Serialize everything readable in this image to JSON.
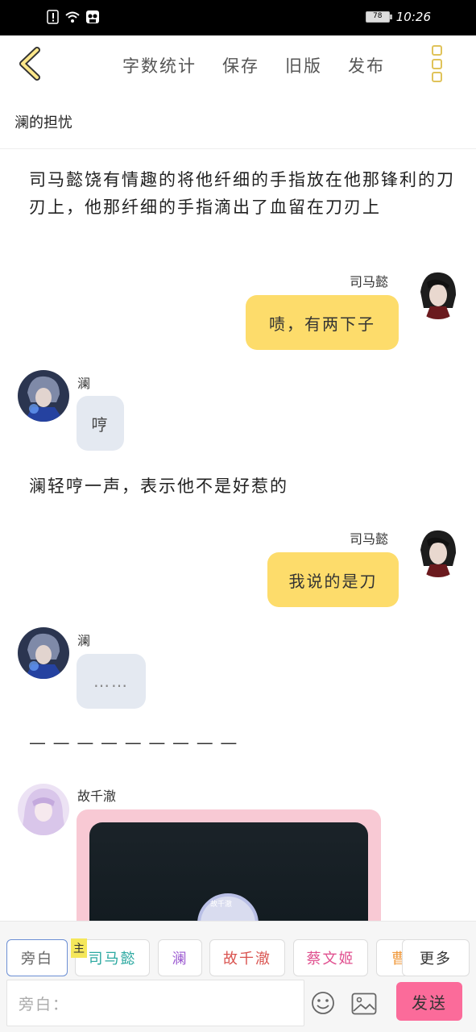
{
  "status_bar": {
    "battery": "78",
    "time": "10:26",
    "icons": [
      "alert-icon",
      "wifi-icon",
      "app-icon"
    ]
  },
  "toolbar": {
    "back_icon": "chevron-left-icon",
    "items": [
      "字数统计",
      "保存",
      "旧版",
      "发布"
    ],
    "more_icon": "more-vertical-icon",
    "accent": "#e0c35a"
  },
  "doc": {
    "title": "澜的担忧"
  },
  "messages": {
    "narration1": "司马懿饶有情趣的将他纤细的手指放在他那锋利的刀刃上，他那纤细的手指滴出了血留在刀刃上",
    "m1": {
      "name": "司马懿",
      "text": "啧，有两下子"
    },
    "m2": {
      "name": "澜",
      "text": "哼"
    },
    "narration2": "澜轻哼一声，表示他不是好惹的",
    "m3": {
      "name": "司马懿",
      "text": "我说的是刀"
    },
    "m4": {
      "name": "澜",
      "text": "……"
    },
    "separator": "— — — — — — — — —",
    "m5": {
      "name": "故千澈",
      "image_caption": "故千澈"
    }
  },
  "bottom": {
    "chips": [
      "旁白",
      "司马懿",
      "澜",
      "故千澈",
      "蔡文姬",
      "曹"
    ],
    "badge": "主",
    "more": "更多",
    "input_placeholder": "旁白：",
    "send": "发送",
    "emoji_icon": "smiley-icon",
    "image_icon": "image-icon",
    "send_color": "#fb6b9a"
  }
}
